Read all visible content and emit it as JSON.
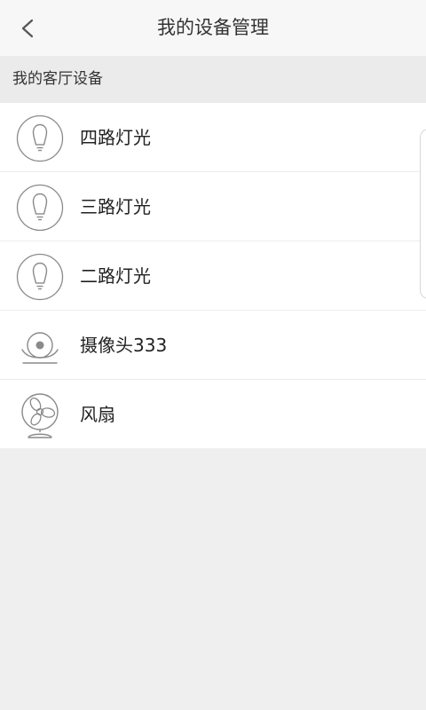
{
  "header": {
    "title": "我的设备管理",
    "back_icon": "chevron-left-icon"
  },
  "section": {
    "title": "我的客厅设备"
  },
  "devices": [
    {
      "label": "四路灯光",
      "icon": "light-bulb-icon"
    },
    {
      "label": "三路灯光",
      "icon": "light-bulb-icon"
    },
    {
      "label": "二路灯光",
      "icon": "light-bulb-icon"
    },
    {
      "label": "摄像头333",
      "icon": "camera-icon"
    },
    {
      "label": "风扇",
      "icon": "fan-icon"
    }
  ],
  "colors": {
    "background": "#efefef",
    "topbar": "#f7f7f7",
    "section_header": "#ebebeb",
    "icon_stroke": "#8a8a8a"
  }
}
